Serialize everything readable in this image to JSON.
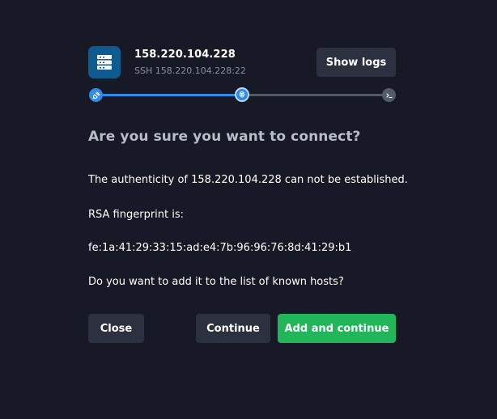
{
  "host": {
    "title": "158.220.104.228",
    "subtitle": "SSH 158.220.104.228:22",
    "icon": "server-icon",
    "icon_color": "#0f5a8f"
  },
  "header": {
    "show_logs_label": "Show logs"
  },
  "progress": {
    "steps": [
      {
        "icon": "plug-icon",
        "state": "done"
      },
      {
        "icon": "fingerprint-icon",
        "state": "active"
      },
      {
        "icon": "terminal-icon",
        "state": "pending"
      }
    ],
    "accent": "#2f8ae8",
    "inactive": "#555a68"
  },
  "dialog": {
    "question": "Are you sure you want to connect?",
    "authenticity_text": "The authenticity of 158.220.104.228 can not be established.",
    "fingerprint_label": "RSA fingerprint is:",
    "fingerprint": "fe:1a:41:29:33:15:ad:e4:7b:96:96:76:8d:41:29:b1",
    "prompt": "Do you want to add it to the list of known hosts?"
  },
  "actions": {
    "close_label": "Close",
    "continue_label": "Continue",
    "add_continue_label": "Add and continue",
    "primary_color": "#22b55a"
  }
}
